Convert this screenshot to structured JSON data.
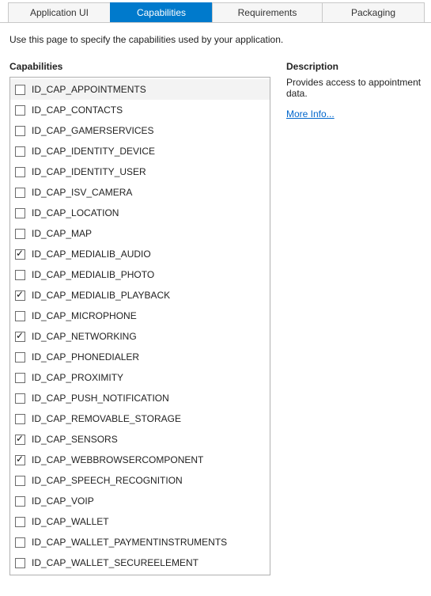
{
  "tabs": [
    {
      "label": "Application UI",
      "active": false
    },
    {
      "label": "Capabilities",
      "active": true
    },
    {
      "label": "Requirements",
      "active": false
    },
    {
      "label": "Packaging",
      "active": false
    }
  ],
  "intro": "Use this page to specify the capabilities used by your application.",
  "left_title": "Capabilities",
  "right_title": "Description",
  "description": "Provides access to appointment data.",
  "more_info_label": "More Info...",
  "capabilities": [
    {
      "name": "ID_CAP_APPOINTMENTS",
      "checked": false,
      "selected": true
    },
    {
      "name": "ID_CAP_CONTACTS",
      "checked": false,
      "selected": false
    },
    {
      "name": "ID_CAP_GAMERSERVICES",
      "checked": false,
      "selected": false
    },
    {
      "name": "ID_CAP_IDENTITY_DEVICE",
      "checked": false,
      "selected": false
    },
    {
      "name": "ID_CAP_IDENTITY_USER",
      "checked": false,
      "selected": false
    },
    {
      "name": "ID_CAP_ISV_CAMERA",
      "checked": false,
      "selected": false
    },
    {
      "name": "ID_CAP_LOCATION",
      "checked": false,
      "selected": false
    },
    {
      "name": "ID_CAP_MAP",
      "checked": false,
      "selected": false
    },
    {
      "name": "ID_CAP_MEDIALIB_AUDIO",
      "checked": true,
      "selected": false
    },
    {
      "name": "ID_CAP_MEDIALIB_PHOTO",
      "checked": false,
      "selected": false
    },
    {
      "name": "ID_CAP_MEDIALIB_PLAYBACK",
      "checked": true,
      "selected": false
    },
    {
      "name": "ID_CAP_MICROPHONE",
      "checked": false,
      "selected": false
    },
    {
      "name": "ID_CAP_NETWORKING",
      "checked": true,
      "selected": false
    },
    {
      "name": "ID_CAP_PHONEDIALER",
      "checked": false,
      "selected": false
    },
    {
      "name": "ID_CAP_PROXIMITY",
      "checked": false,
      "selected": false
    },
    {
      "name": "ID_CAP_PUSH_NOTIFICATION",
      "checked": false,
      "selected": false
    },
    {
      "name": "ID_CAP_REMOVABLE_STORAGE",
      "checked": false,
      "selected": false
    },
    {
      "name": "ID_CAP_SENSORS",
      "checked": true,
      "selected": false
    },
    {
      "name": "ID_CAP_WEBBROWSERCOMPONENT",
      "checked": true,
      "selected": false
    },
    {
      "name": "ID_CAP_SPEECH_RECOGNITION",
      "checked": false,
      "selected": false
    },
    {
      "name": "ID_CAP_VOIP",
      "checked": false,
      "selected": false
    },
    {
      "name": "ID_CAP_WALLET",
      "checked": false,
      "selected": false
    },
    {
      "name": "ID_CAP_WALLET_PAYMENTINSTRUMENTS",
      "checked": false,
      "selected": false
    },
    {
      "name": "ID_CAP_WALLET_SECUREELEMENT",
      "checked": false,
      "selected": false
    }
  ]
}
